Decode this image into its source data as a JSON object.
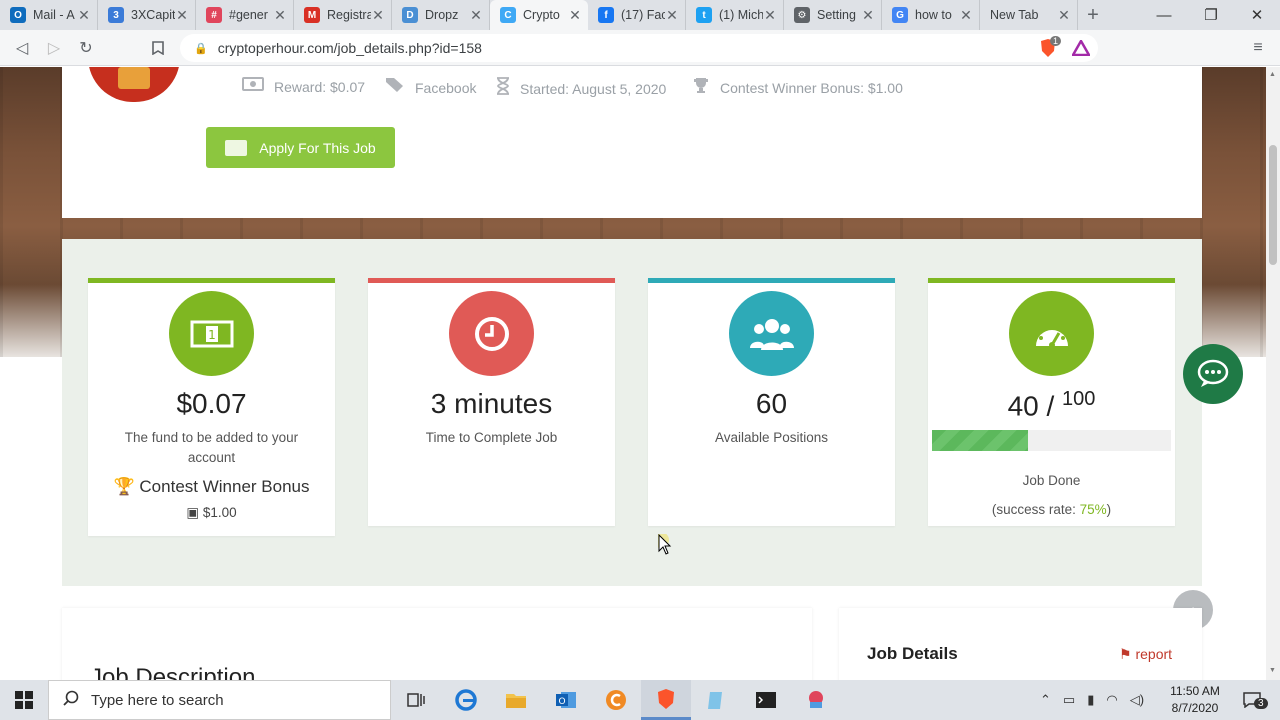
{
  "browser": {
    "tabs": [
      {
        "title": "Mail - A",
        "color": "#0f6cbd",
        "glyph": "O"
      },
      {
        "title": "3XCapit",
        "color": "#3b7bd8",
        "glyph": "3"
      },
      {
        "title": "#gener",
        "color": "#e0455c",
        "glyph": "#"
      },
      {
        "title": "Registra",
        "color": "#d93025",
        "glyph": "M"
      },
      {
        "title": "Dropz",
        "color": "#4a8fd4",
        "glyph": "D"
      },
      {
        "title": "Crypto",
        "color": "#3fa9f5",
        "glyph": "C"
      },
      {
        "title": "(17) Fac",
        "color": "#1877f2",
        "glyph": "f"
      },
      {
        "title": "(1) Mich",
        "color": "#1da1f2",
        "glyph": "t"
      },
      {
        "title": "Setting",
        "color": "#5f6368",
        "glyph": "⚙"
      },
      {
        "title": "how to",
        "color": "#4285f4",
        "glyph": "G"
      },
      {
        "title": "New Tab",
        "color": "",
        "glyph": ""
      }
    ],
    "url": "cryptoperhour.com/job_details.php?id=158",
    "brave_badge": "1"
  },
  "job": {
    "reward": "Reward: $0.07",
    "category": "Facebook",
    "started": "Started: August 5, 2020",
    "contest_bonus": "Contest Winner Bonus: $1.00",
    "apply_label": "Apply For This Job"
  },
  "stats": {
    "reward": {
      "value": "$0.07",
      "desc": "The fund to be added to your account",
      "bonus_label": "Contest Winner Bonus",
      "bonus_amount": "$1.00",
      "color": "#7fb722"
    },
    "time": {
      "value": "3 minutes",
      "desc": "Time to Complete Job",
      "color": "#e05a56"
    },
    "positions": {
      "value": "60",
      "desc": "Available Positions",
      "color": "#2eaab7"
    },
    "done": {
      "value": "40 / ",
      "total": "100",
      "desc": "Job Done",
      "success_prefix": "(success rate: ",
      "success_rate": "75%",
      "success_suffix": ")",
      "progress": 0.4,
      "color": "#7fb722"
    }
  },
  "sections": {
    "description_title": "Job Description",
    "details_title": "Job Details",
    "report_label": "report"
  },
  "taskbar": {
    "search_placeholder": "Type here to search",
    "time": "11:50 AM",
    "date": "8/7/2020",
    "notifications": "3"
  }
}
